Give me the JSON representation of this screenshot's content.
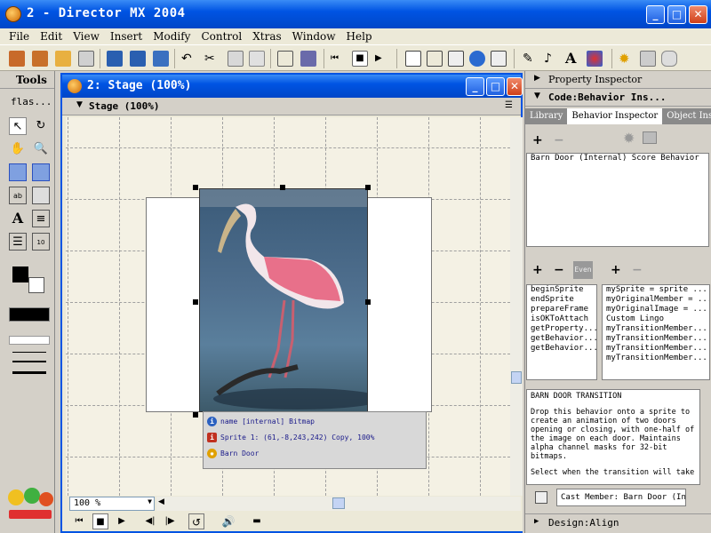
{
  "window": {
    "title": "2 - Director MX 2004"
  },
  "menu": [
    "File",
    "Edit",
    "View",
    "Insert",
    "Modify",
    "Control",
    "Xtras",
    "Window",
    "Help"
  ],
  "tools_panel": {
    "title": "Tools",
    "dropdown": "flas..."
  },
  "stage": {
    "window_title": "2: Stage (100%)",
    "panel_title": "Stage (100%)",
    "info_rows": [
      "name [internal] Bitmap",
      "Sprite 1: (61,-8,243,242) Copy, 100%",
      "Barn Door"
    ],
    "zoom": "100 %"
  },
  "right_panel": {
    "property_inspector": "Property Inspector",
    "code_title": "Code:Behavior Ins...",
    "tabs": [
      "Library",
      "Behavior Inspector",
      "Object Ins"
    ],
    "active_tab": 1,
    "behaviors": [
      "Barn Door (Internal) Score Behavior"
    ],
    "events_btn": "Even",
    "handlers": [
      "beginSprite",
      "endSprite",
      "prepareFrame",
      "isOKToAttach",
      "getProperty...",
      "getBehavior...",
      "getBehavior..."
    ],
    "properties": [
      "mySprite = sprite ...",
      "myOriginalMember = ...",
      "myOriginalImage = ...",
      "Custom Lingo",
      "myTransitionMember...",
      "myTransitionMember...",
      "myTransitionMember...",
      "myTransitionMember..."
    ],
    "description_title": "BARN DOOR TRANSITION",
    "description": "Drop this behavior onto a sprite to create an animation of two doors opening or closing, with one-half of the image on each door. Maintains alpha channel masks for 32-bit bitmaps.",
    "description_more": "Select when the transition will take",
    "cast_member": "Cast Member:  Barn Door (In",
    "design_align": "Design:Align"
  },
  "colors": {
    "titlebar": "#0054e3",
    "chrome": "#ece9d8",
    "panel": "#d4d0c8"
  }
}
